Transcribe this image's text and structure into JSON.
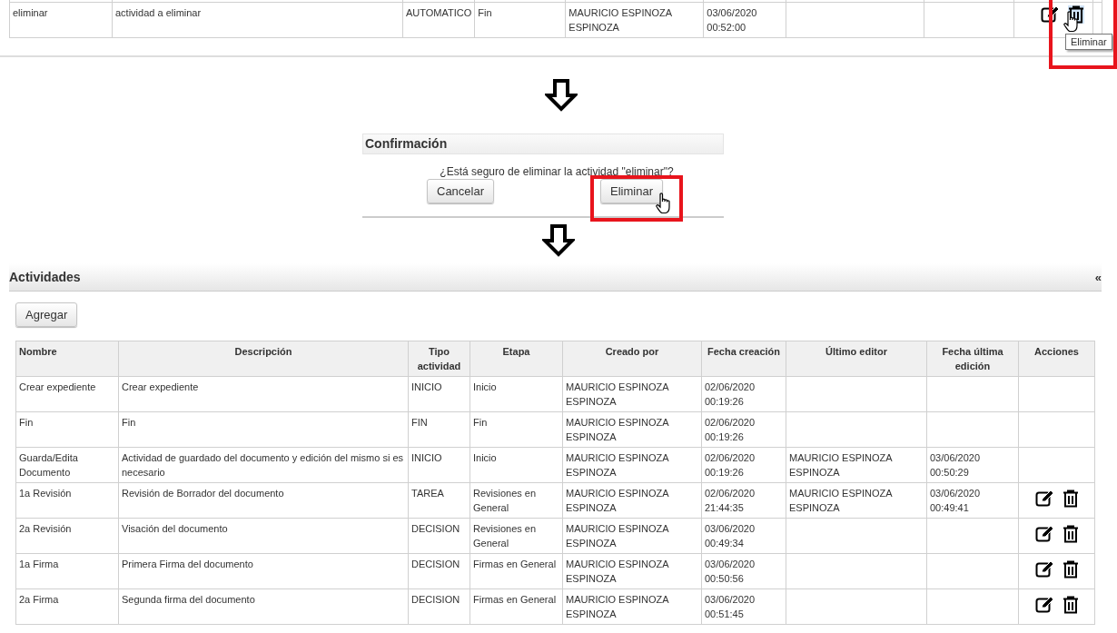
{
  "top_table": {
    "rows": [
      {
        "cells": [
          "eliminar",
          "actividad a eliminar",
          "AUTOMATICO",
          "Fin",
          "MAURICIO ESPINOZA ESPINOZA",
          "03/06/2020 00:52:00",
          "",
          ""
        ],
        "has_actions": true
      }
    ],
    "tooltip": "Eliminar"
  },
  "confirm_dialog": {
    "title": "Confirmación",
    "message": "¿Está seguro de eliminar la actividad \"eliminar\"?",
    "buttons": [
      "Cancelar",
      "Eliminar"
    ]
  },
  "panel": {
    "title": "Actividades",
    "collapse": "«",
    "add_button": "Agregar",
    "table": {
      "columns": [
        "Nombre",
        "Descripción",
        "Tipo actividad",
        "Etapa",
        "Creado por",
        "Fecha creación",
        "Último editor",
        "Fecha última edición",
        "Acciones"
      ],
      "rows": [
        {
          "cells": [
            "Crear expediente",
            "Crear expediente",
            "INICIO",
            "Inicio",
            "MAURICIO ESPINOZA ESPINOZA",
            "02/06/2020 00:19:26",
            "",
            ""
          ],
          "has_actions": false
        },
        {
          "cells": [
            "Fin",
            "Fin",
            "FIN",
            "Fin",
            "MAURICIO ESPINOZA ESPINOZA",
            "02/06/2020 00:19:26",
            "",
            ""
          ],
          "has_actions": false
        },
        {
          "cells": [
            "Guarda/Edita Documento",
            "Actividad de guardado del documento y edición del mismo si es necesario",
            "INICIO",
            "Inicio",
            "MAURICIO ESPINOZA ESPINOZA",
            "02/06/2020 00:19:26",
            "MAURICIO ESPINOZA ESPINOZA",
            "03/06/2020 00:50:29"
          ],
          "has_actions": false
        },
        {
          "cells": [
            "1a Revisión",
            "Revisión de Borrador del documento",
            "TAREA",
            "Revisiones en General",
            "MAURICIO ESPINOZA ESPINOZA",
            "02/06/2020 21:44:35",
            "MAURICIO ESPINOZA ESPINOZA",
            "03/06/2020 00:49:41"
          ],
          "has_actions": true
        },
        {
          "cells": [
            "2a Revisión",
            "Visación del documento",
            "DECISION",
            "Revisiones en General",
            "MAURICIO ESPINOZA ESPINOZA",
            "03/06/2020 00:49:34",
            "",
            ""
          ],
          "has_actions": true
        },
        {
          "cells": [
            "1a Firma",
            "Primera Firma del documento",
            "DECISION",
            "Firmas en General",
            "MAURICIO ESPINOZA ESPINOZA",
            "03/06/2020 00:50:56",
            "",
            ""
          ],
          "has_actions": true
        },
        {
          "cells": [
            "2a Firma",
            "Segunda firma del documento",
            "DECISION",
            "Firmas en General",
            "MAURICIO ESPINOZA ESPINOZA",
            "03/06/2020 00:51:45",
            "",
            ""
          ],
          "has_actions": true
        }
      ]
    }
  }
}
